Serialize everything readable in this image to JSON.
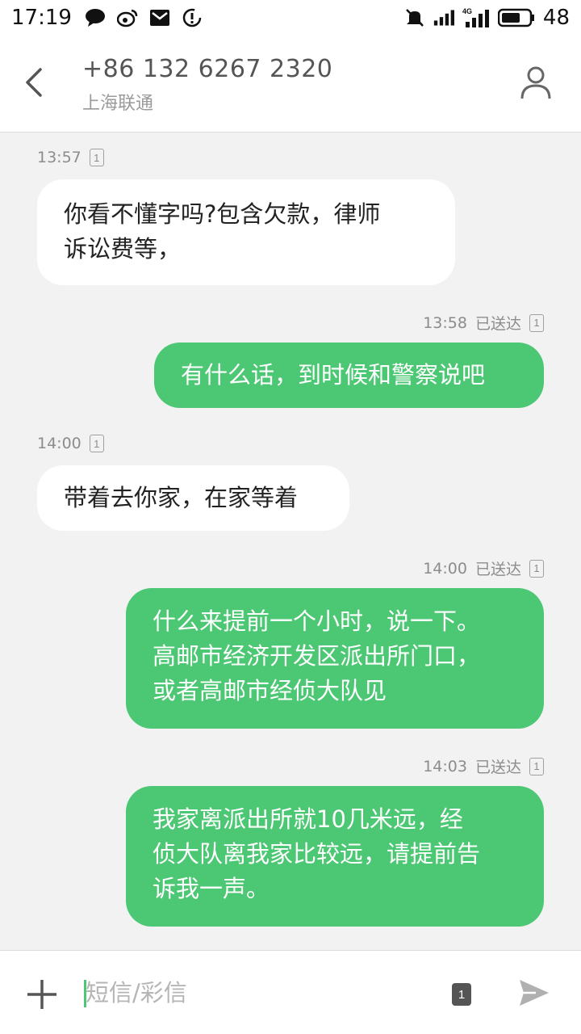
{
  "status_bar": {
    "time": "17:19",
    "battery": "48",
    "network": "4G",
    "icons": [
      "message-icon",
      "weibo-icon",
      "mail-icon",
      "sync-icon",
      "mute-icon",
      "signal-icon",
      "signal-4g-icon",
      "battery-icon"
    ]
  },
  "header": {
    "phone": "+86 132 6267 2320",
    "carrier": "上海联通"
  },
  "messages": [
    {
      "direction": "in",
      "time": "13:57",
      "sim": "1",
      "text": "你看不懂字吗?包含欠款，律师\n诉讼费等，"
    },
    {
      "direction": "out",
      "time": "13:58",
      "status": "已送达",
      "sim": "1",
      "text": "有什么话，到时候和警察说吧"
    },
    {
      "direction": "in",
      "time": "14:00",
      "sim": "1",
      "text": "带着去你家，在家等着"
    },
    {
      "direction": "out",
      "time": "14:00",
      "status": "已送达",
      "sim": "1",
      "text": "什么来提前一个小时，说一下。\n高邮市经济开发区派出所门口，\n或者高邮市经侦大队见"
    },
    {
      "direction": "out",
      "time": "14:03",
      "status": "已送达",
      "sim": "1",
      "text": "我家离派出所就10几米远，经\n侦大队离我家比较远，请提前告\n诉我一声。"
    }
  ],
  "input": {
    "placeholder": "短信/彩信",
    "value": "",
    "sim": "1"
  },
  "colors": {
    "outgoing_bubble": "#4cc773",
    "incoming_bubble": "#ffffff",
    "background": "#f2f2f2"
  }
}
